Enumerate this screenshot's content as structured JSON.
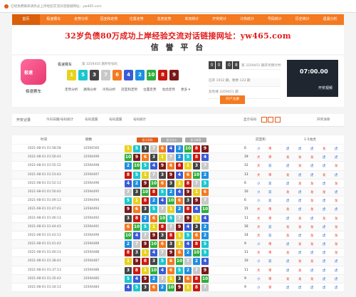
{
  "browser": {
    "title": "已经免费联系请务必上岸经验交流对话链接网址：yw465.com"
  },
  "nav": [
    {
      "label": "首页",
      "active": true
    },
    {
      "label": "极速赛车",
      "active": false
    },
    {
      "label": "走势分析",
      "active": false
    },
    {
      "label": "冠亚和走势",
      "active": false
    },
    {
      "label": "位置走势",
      "active": false
    },
    {
      "label": "龙虎走势",
      "active": false
    },
    {
      "label": "单双统计",
      "active": false
    },
    {
      "label": "开奖统计",
      "active": false
    },
    {
      "label": "冷热统计",
      "active": false
    },
    {
      "label": "号码统计",
      "active": false
    },
    {
      "label": "历史统计",
      "active": false
    },
    {
      "label": "遗漏分析",
      "active": false
    }
  ],
  "banner": {
    "line1": "32岁负债80万成功上岸经验交流对话链接网址：yw465.com",
    "line2": "信 誉 平 台"
  },
  "game": {
    "logo_text": "极速",
    "name": "极速赛车",
    "name_under_logo": "极速赛车",
    "sub": "第 3359450 期开奖号码",
    "balls": [
      {
        "n": "1",
        "c": "#e8d21d"
      },
      {
        "n": "5",
        "c": "#1cc6cf"
      },
      {
        "n": "3",
        "c": "#444444"
      },
      {
        "n": "7",
        "c": "#c8c8c8"
      },
      {
        "n": "6",
        "c": "#f47920"
      },
      {
        "n": "4",
        "c": "#3a5cd6"
      },
      {
        "n": "2",
        "c": "#1e8fe0"
      },
      {
        "n": "10",
        "c": "#2fae3b"
      },
      {
        "n": "8",
        "c": "#c9190f"
      },
      {
        "n": "9",
        "c": "#7a1a1a"
      }
    ],
    "links": [
      "走势分析",
      "路珠分析",
      "冷热分析",
      "冠亚和走势",
      "位置走势",
      "龙虎走势",
      "更多 ▾"
    ]
  },
  "countdown": {
    "label": "第 3359451 期开奖倒计时",
    "digits": [
      "0",
      "0",
      "0",
      "8"
    ],
    "line2": "已开 1012 期，剩余 133 期",
    "line3": "双色球 3359451 期",
    "btn": "开户注册"
  },
  "video": {
    "score": "07:00.00",
    "title": "开奖视频"
  },
  "toolbar": {
    "title": "开奖记录",
    "items": [
      "今日日期/号码统计",
      "号码遗漏",
      "号码遗漏",
      "号码统计"
    ],
    "right": [
      "显示号码",
      "开奖详单"
    ]
  },
  "table": {
    "headers": [
      "时间",
      "期数",
      "开奖号码",
      "冠亚和",
      "1-5龙虎"
    ],
    "toggles": [
      {
        "label": "显示号码",
        "c": "#e25b1a"
      },
      {
        "label": "显示大小",
        "c": "#aaaaaa"
      },
      {
        "label": "显示单双",
        "c": "#aaaaaa"
      }
    ],
    "rows": [
      {
        "t": "2021-08-01 01:58:58",
        "n": "33594500",
        "b": [
          "1",
          "5",
          "3",
          "7",
          "6",
          "4",
          "2",
          "10",
          "8",
          "9"
        ],
        "s": [
          "6",
          "小",
          "单"
        ],
        "d": [
          "虎",
          "虎",
          "虎",
          "龙",
          "虎"
        ]
      },
      {
        "t": "2021-08-01 01:56:43",
        "n": "33594499",
        "b": [
          "10",
          "9",
          "6",
          "3",
          "1",
          "7",
          "2",
          "5",
          "8",
          "4"
        ],
        "s": [
          "19",
          "大",
          "单"
        ],
        "d": [
          "龙",
          "龙",
          "龙",
          "虎",
          "虎"
        ]
      },
      {
        "t": "2021-08-01 01:55:12",
        "n": "33594498",
        "b": [
          "2",
          "10",
          "5",
          "4",
          "9",
          "6",
          "8",
          "1",
          "3",
          "7"
        ],
        "s": [
          "12",
          "大",
          "双"
        ],
        "d": [
          "虎",
          "龙",
          "虎",
          "虎",
          "龙"
        ]
      },
      {
        "t": "2021-08-01 01:53:43",
        "n": "33594497",
        "b": [
          "8",
          "5",
          "1",
          "7",
          "3",
          "9",
          "4",
          "6",
          "10",
          "2"
        ],
        "s": [
          "13",
          "大",
          "单"
        ],
        "d": [
          "龙",
          "虎",
          "虎",
          "龙",
          "虎"
        ]
      },
      {
        "t": "2021-08-01 01:52:13",
        "n": "33594496",
        "b": [
          "4",
          "2",
          "9",
          "10",
          "6",
          "3",
          "1",
          "8",
          "7",
          "5"
        ],
        "s": [
          "6",
          "小",
          "双"
        ],
        "d": [
          "虎",
          "龙",
          "龙",
          "虎",
          "龙"
        ]
      },
      {
        "t": "2021-08-01 01:50:43",
        "n": "33594495",
        "b": [
          "7",
          "3",
          "10",
          "8",
          "5",
          "2",
          "4",
          "9",
          "1",
          "6"
        ],
        "s": [
          "10",
          "小",
          "双"
        ],
        "d": [
          "龙",
          "虎",
          "龙",
          "龙",
          "虎"
        ]
      },
      {
        "t": "2021-08-01 01:49:13",
        "n": "33594494",
        "b": [
          "5",
          "1",
          "8",
          "2",
          "4",
          "10",
          "6",
          "3",
          "9",
          "7"
        ],
        "s": [
          "6",
          "小",
          "双"
        ],
        "d": [
          "虎",
          "虎",
          "龙",
          "虎",
          "龙"
        ]
      },
      {
        "t": "2021-08-01 01:47:43",
        "n": "33594493",
        "b": [
          "9",
          "6",
          "3",
          "5",
          "7",
          "1",
          "2",
          "8",
          "4",
          "10"
        ],
        "s": [
          "15",
          "大",
          "单"
        ],
        "d": [
          "龙",
          "虎",
          "龙",
          "虎",
          "虎"
        ]
      },
      {
        "t": "2021-08-01 01:46:13",
        "n": "33594492",
        "b": [
          "3",
          "8",
          "2",
          "6",
          "10",
          "5",
          "7",
          "9",
          "1",
          "4"
        ],
        "s": [
          "11",
          "大",
          "单"
        ],
        "d": [
          "虎",
          "龙",
          "虎",
          "龙",
          "龙"
        ]
      },
      {
        "t": "2021-08-01 01:44:43",
        "n": "33594491",
        "b": [
          "6",
          "10",
          "5",
          "1",
          "8",
          "7",
          "9",
          "4",
          "3",
          "2"
        ],
        "s": [
          "16",
          "大",
          "双"
        ],
        "d": [
          "龙",
          "龙",
          "龙",
          "虎",
          "龙"
        ]
      },
      {
        "t": "2021-08-01 01:43:13",
        "n": "33594490",
        "b": [
          "10",
          "4",
          "7",
          "9",
          "3",
          "8",
          "1",
          "5",
          "6",
          "2"
        ],
        "s": [
          "14",
          "大",
          "双"
        ],
        "d": [
          "龙",
          "虎",
          "龙",
          "虎",
          "龙"
        ]
      },
      {
        "t": "2021-08-01 01:41:43",
        "n": "33594489",
        "b": [
          "2",
          "7",
          "9",
          "10",
          "6",
          "3",
          "1",
          "4",
          "8",
          "5"
        ],
        "s": [
          "9",
          "小",
          "单"
        ],
        "d": [
          "虎",
          "龙",
          "龙",
          "虎",
          "龙"
        ]
      },
      {
        "t": "2021-08-01 01:40:13",
        "n": "33594488",
        "b": [
          "8",
          "3",
          "1",
          "4",
          "7",
          "9",
          "6",
          "2",
          "10",
          "5"
        ],
        "s": [
          "11",
          "大",
          "单"
        ],
        "d": [
          "龙",
          "虎",
          "虎",
          "虎",
          "龙"
        ]
      },
      {
        "t": "2021-08-01 01:38:43",
        "n": "33594487",
        "b": [
          "1",
          "9",
          "8",
          "3",
          "5",
          "6",
          "10",
          "7",
          "2",
          "4"
        ],
        "s": [
          "10",
          "小",
          "双"
        ],
        "d": [
          "虎",
          "龙",
          "龙",
          "虎",
          "虎"
        ]
      },
      {
        "t": "2021-08-01 01:37:13",
        "n": "33594486",
        "b": [
          "3",
          "8",
          "1",
          "10",
          "4",
          "6",
          "5",
          "2",
          "7",
          "9"
        ],
        "s": [
          "11",
          "大",
          "单"
        ],
        "d": [
          "虎",
          "龙",
          "虎",
          "虎",
          "虎"
        ]
      },
      {
        "t": "2021-08-01 01:35:43",
        "n": "33594485",
        "b": [
          "5",
          "4",
          "9",
          "2",
          "7",
          "1",
          "3",
          "6",
          "8",
          "10"
        ],
        "s": [
          "9",
          "小",
          "单"
        ],
        "d": [
          "龙",
          "龙",
          "龙",
          "虎",
          "虎"
        ]
      },
      {
        "t": "2021-08-01 01:34:13",
        "n": "33594484",
        "b": [
          "4",
          "5",
          "3",
          "6",
          "2",
          "10",
          "9",
          "1",
          "8",
          "7"
        ],
        "s": [
          "9",
          "小",
          "单"
        ],
        "d": [
          "虎",
          "虎",
          "虎",
          "虎",
          "虎"
        ]
      }
    ]
  },
  "colors": {
    "1": "#e8d21d",
    "2": "#1e8fe0",
    "3": "#444444",
    "4": "#3a5cd6",
    "5": "#1cc6cf",
    "6": "#f47920",
    "7": "#c8c8c8",
    "8": "#c9190f",
    "9": "#7a1a1a",
    "10": "#2fae3b"
  }
}
